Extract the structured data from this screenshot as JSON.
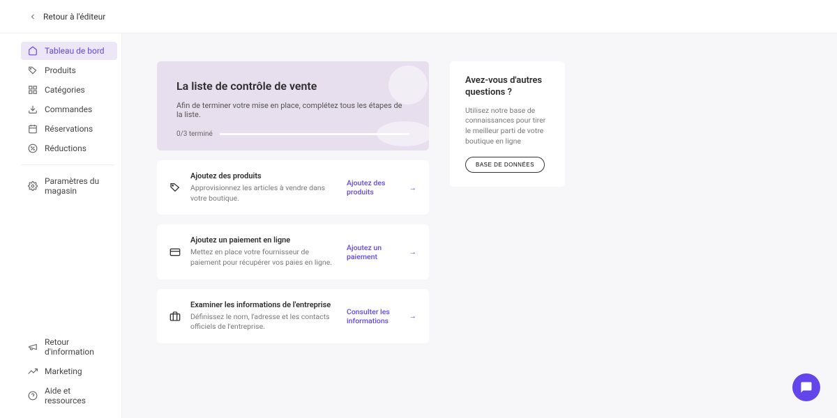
{
  "topbar": {
    "back_label": "Retour à l'éditeur"
  },
  "sidebar": {
    "items": [
      {
        "label": "Tableau de bord",
        "icon": "home-icon",
        "active": true
      },
      {
        "label": "Produits",
        "icon": "tag-icon"
      },
      {
        "label": "Catégories",
        "icon": "grid-icon"
      },
      {
        "label": "Commandes",
        "icon": "download-icon"
      },
      {
        "label": "Réservations",
        "icon": "calendar-icon"
      },
      {
        "label": "Réductions",
        "icon": "percent-icon"
      }
    ],
    "settings_label": "Paramètres du magasin",
    "bottom": [
      {
        "label": "Retour d'information",
        "icon": "megaphone-icon"
      },
      {
        "label": "Marketing",
        "icon": "trend-icon"
      },
      {
        "label": "Aide et ressources",
        "icon": "help-icon"
      }
    ]
  },
  "checklist": {
    "title": "La liste de contrôle de vente",
    "description": "Afin de terminer votre mise en place, complétez tous les étapes de la liste.",
    "progress": "0/3 terminé",
    "tasks": [
      {
        "title": "Ajoutez des produits",
        "desc": "Approvisionnez les articles à vendre dans votre boutique.",
        "cta": "Ajoutez des produits",
        "icon": "tag-icon"
      },
      {
        "title": "Ajoutez un paiement en ligne",
        "desc": "Mettez en place votre fournisseur de paiement pour récupérer vos paies en ligne.",
        "cta": "Ajoutez un paiement",
        "icon": "card-icon"
      },
      {
        "title": "Examiner les informations de l'entreprise",
        "desc": "Définissez le nom, l'adresse et les contacts officiels de l'entreprise.",
        "cta": "Consulter les informations",
        "icon": "briefcase-icon"
      }
    ]
  },
  "help": {
    "title": "Avez-vous d'autres questions ?",
    "desc": "Utilisez notre base de connaissances pour tirer le meilleur parti de votre boutique en ligne",
    "cta": "BASE DE DONNÉES"
  },
  "colors": {
    "accent": "#6246ea",
    "hero_bg": "#e7deee"
  }
}
